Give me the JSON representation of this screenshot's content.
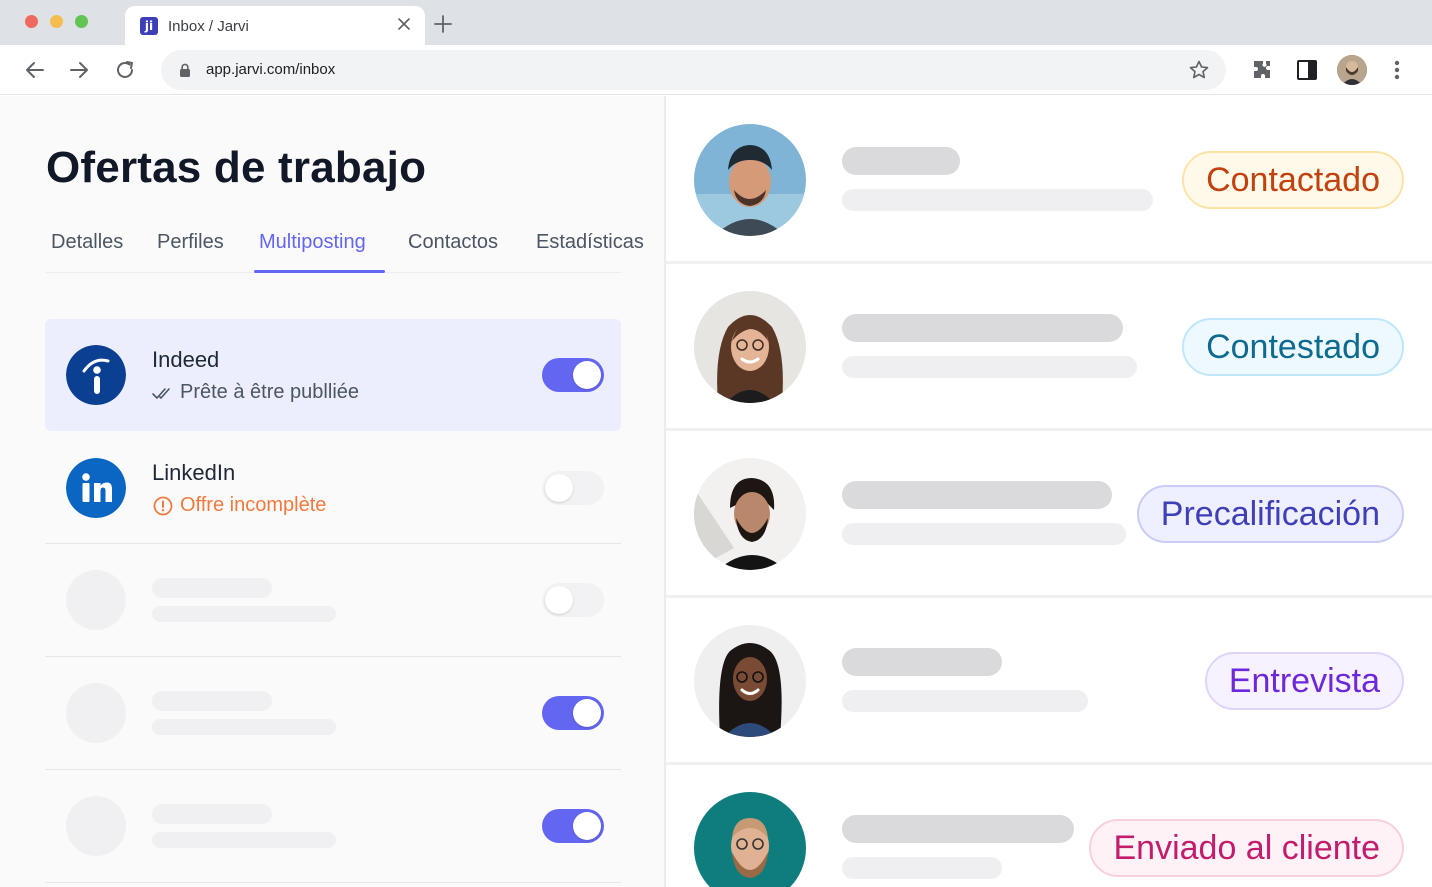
{
  "browser": {
    "tab_title": "Inbox / Jarvi",
    "favicon_text": "ji",
    "url": "app.jarvi.com/inbox",
    "icons": [
      "back-icon",
      "forward-icon",
      "reload-icon",
      "lock-icon",
      "star-icon",
      "extensions-icon",
      "sidepanel-icon",
      "profile-avatar",
      "menu-icon"
    ]
  },
  "left": {
    "title": "Ofertas de trabajo",
    "tabs": [
      {
        "label": "Detalles",
        "active": false
      },
      {
        "label": "Perfiles",
        "active": false
      },
      {
        "label": "Multiposting",
        "active": true
      },
      {
        "label": "Contactos",
        "active": false
      },
      {
        "label": "Estadísticas",
        "active": false
      }
    ],
    "publishers": [
      {
        "name": "Indeed",
        "status": "Prête à être publliée",
        "status_type": "ready",
        "enabled": true,
        "logo_color": "#0b3f91"
      },
      {
        "name": "LinkedIn",
        "status": "Offre incomplète",
        "status_type": "warning",
        "enabled": false,
        "logo_color": "#0a66c2"
      }
    ],
    "placeholder_rows": [
      {
        "enabled": false
      },
      {
        "enabled": true
      },
      {
        "enabled": true
      }
    ]
  },
  "right": {
    "candidates": [
      {
        "status": "Contactado",
        "color": "#c2410c",
        "bg": "#fff9ea",
        "border": "#fbe3a8"
      },
      {
        "status": "Contestado",
        "color": "#0e6b8f",
        "bg": "#eef9ff",
        "border": "#bfe6f9"
      },
      {
        "status": "Precalificación",
        "color": "#3f3fb8",
        "bg": "#eef0ff",
        "border": "#c9cdf6"
      },
      {
        "status": "Entrevista",
        "color": "#6d28d9",
        "bg": "#f7f2ff",
        "border": "#e1d4fb"
      },
      {
        "status": "Enviado al cliente",
        "color": "#c21d6d",
        "bg": "#fff2f7",
        "border": "#f8cfe0"
      }
    ]
  },
  "colors": {
    "accent": "#6366f1",
    "warning": "#f07a3e"
  }
}
